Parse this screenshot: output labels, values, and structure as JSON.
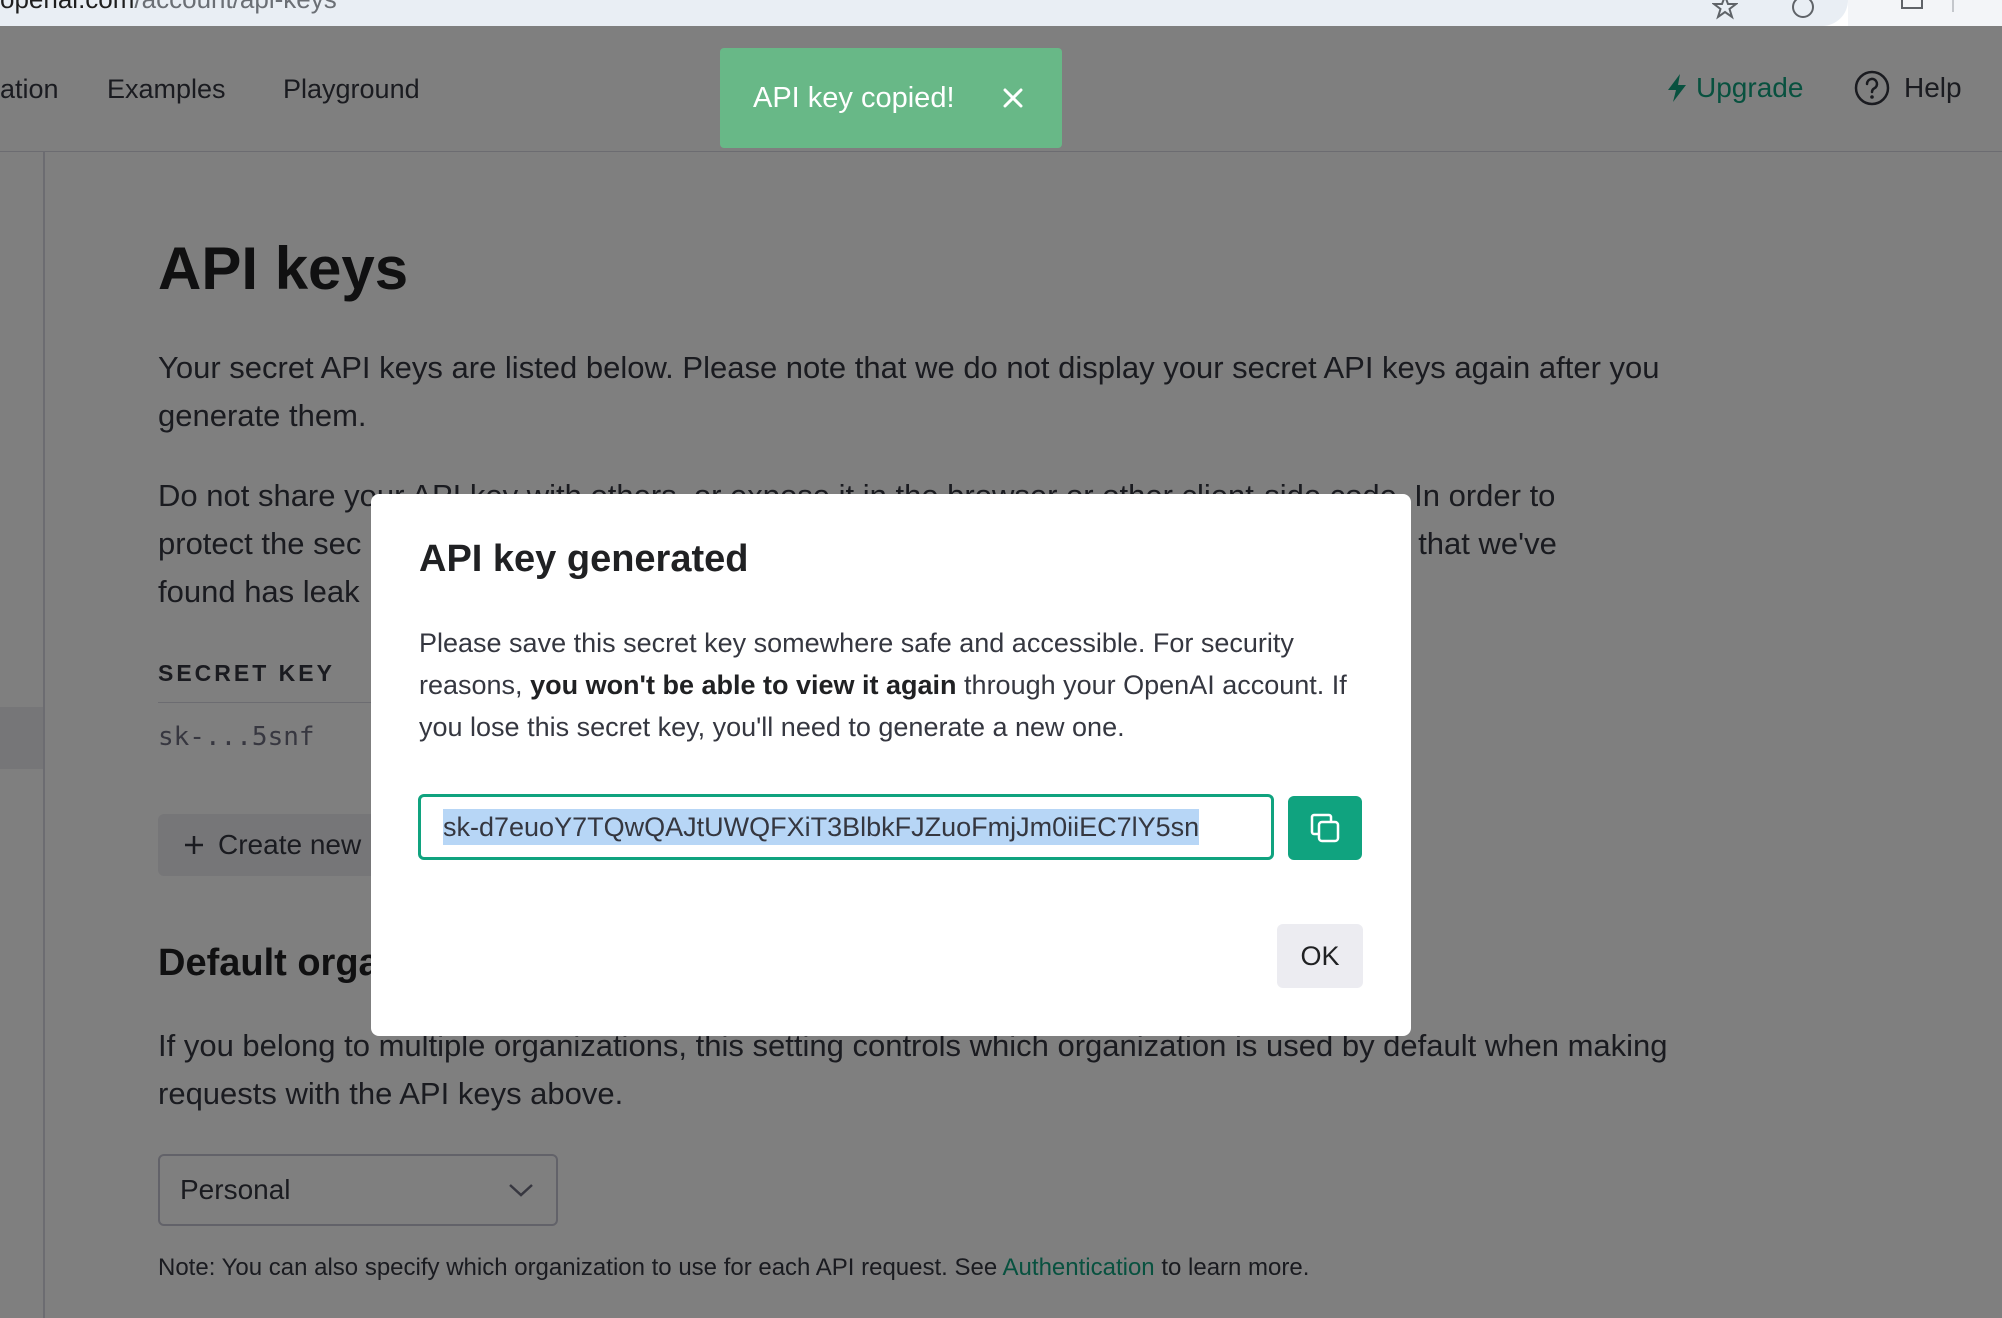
{
  "browser": {
    "url_host": "openai.com",
    "url_path": "/account/api-keys"
  },
  "nav": {
    "items": [
      {
        "label": "ation"
      },
      {
        "label": "Examples"
      },
      {
        "label": "Playground"
      }
    ],
    "upgrade_label": "Upgrade",
    "help_label": "Help"
  },
  "toast": {
    "message": "API key copied!"
  },
  "page": {
    "title": "API keys",
    "intro": "Your secret API keys are listed below. Please note that we do not display your secret API keys again after you generate them.",
    "warning_visible": [
      "Do not share y",
      "our API key with others, or expose it in the browser or other client-side code. In order to",
      "protect the sec",
      "key that we've",
      "found has leak"
    ],
    "secret_key_header": "SECRET KEY",
    "secret_key_value": "sk-...5snf",
    "create_button_label": "Create new",
    "default_org_title": "Default orga",
    "default_org_desc": "If you belong to multiple organizations, this setting controls which organization is used by default when making requests with the API keys above.",
    "org_select_value": "Personal",
    "note_prefix": "Note: You can also specify which organization to use for each API request. See ",
    "note_link": "Authentication",
    "note_suffix": " to learn more."
  },
  "modal": {
    "title": "API key generated",
    "body_part1": "Please save this secret key somewhere safe and accessible. For security reasons, ",
    "body_bold": "you won't be able to view it again",
    "body_part2": " through your OpenAI account. If you lose this secret key, you'll need to generate a new one.",
    "key_value": "sk-d7euoY7TQwQAJtUWQFXiT3BlbkFJZuoFmjJm0iiEC7lY5sn",
    "ok_label": "OK"
  },
  "colors": {
    "accent": "#10a37f",
    "toast_bg": "#68b887",
    "selection": "#b7d6f6"
  }
}
